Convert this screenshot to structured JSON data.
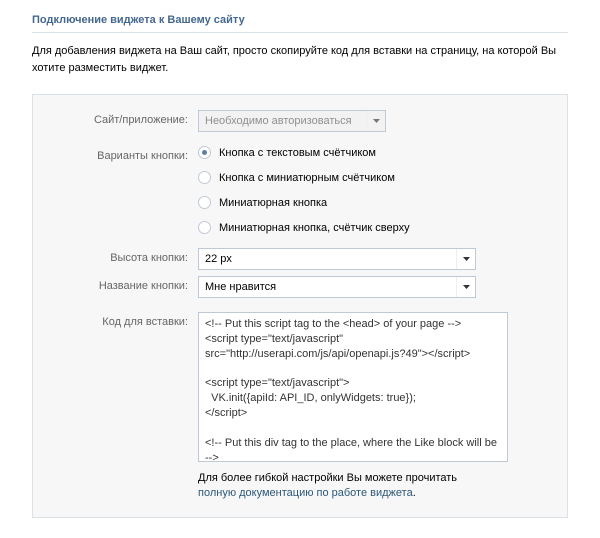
{
  "header": "Подключение виджета к Вашему сайту",
  "intro": "Для добавления виджета на Ваш сайт, просто скопируйте код для вставки на страницу, на которой Вы хотите разместить виджет.",
  "labels": {
    "site": "Сайт/приложение:",
    "variants": "Варианты кнопки:",
    "height": "Высота кнопки:",
    "name": "Название кнопки:",
    "code": "Код для вставки:"
  },
  "site_select": {
    "value": "Необходимо авторизоваться"
  },
  "variants": [
    {
      "label": "Кнопка с текстовым счётчиком",
      "selected": true
    },
    {
      "label": "Кнопка с миниатюрным счётчиком",
      "selected": false
    },
    {
      "label": "Миниатюрная кнопка",
      "selected": false
    },
    {
      "label": "Миниатюрная кнопка, счётчик сверху",
      "selected": false
    }
  ],
  "height_select": {
    "value": "22 px"
  },
  "name_select": {
    "value": "Мне нравится"
  },
  "code": "<!-- Put this script tag to the <head> of your page -->\n<script type=\"text/javascript\" src=\"http://userapi.com/js/api/openapi.js?49\"></script>\n\n<script type=\"text/javascript\">\n  VK.init({apiId: API_ID, onlyWidgets: true});\n</script>\n\n<!-- Put this div tag to the place, where the Like block will be -->\n<div id=\"vk_like\"></div>\n<script type=\"text/javascript\">",
  "footer": {
    "text1": "Для более гибкой настройки Вы можете прочитать ",
    "link": "полную документацию по работе виджета",
    "text2": "."
  }
}
